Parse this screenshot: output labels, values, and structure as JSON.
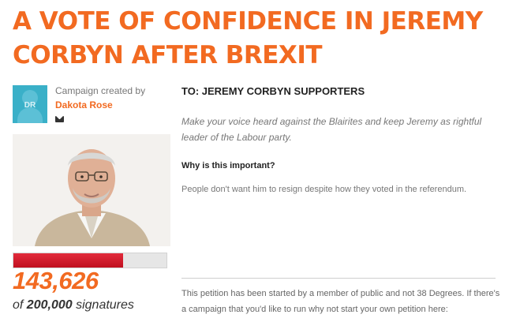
{
  "campaign": {
    "title": "A VOTE OF CONFIDENCE IN JEREMY CORBYN AFTER BREXIT",
    "created_by_label": "Campaign created by",
    "creator_name": "Dakota Rose",
    "creator_initials": "DR"
  },
  "signatures": {
    "count": "143,626",
    "goal_prefix": "of ",
    "goal": "200,000",
    "goal_suffix": " signatures",
    "progress_fraction": 0.718
  },
  "petition": {
    "to": "TO: JEREMY CORBYN SUPPORTERS",
    "intro": "Make your voice heard against the Blairites and keep Jeremy as rightful leader of the Labour party.",
    "why_heading": "Why is this important?",
    "reason": "People don't want him to resign despite how they voted in the referendum.",
    "footer_note": "This petition has been started by a member of public and not 38 Degrees. If there's a campaign that you'd like to run why not start your own petition here:"
  },
  "colors": {
    "accent": "#f26a21",
    "progress": "#d41d2e",
    "avatar": "#3ab0c8"
  },
  "icons": [
    "mail-icon",
    "avatar-icon"
  ]
}
